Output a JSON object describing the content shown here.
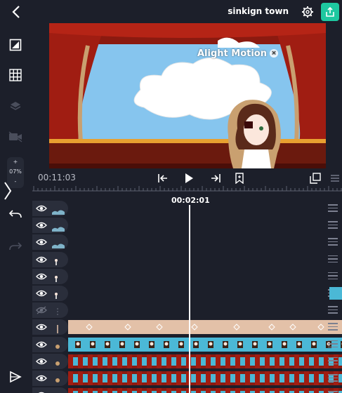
{
  "header": {
    "project_name": "sinkign town",
    "back_icon": "chevron-left-icon",
    "settings_icon": "gear-icon",
    "export_icon": "share-export-icon",
    "export_color": "#1ec8a0"
  },
  "left_tools": {
    "items": [
      "aspect-ratio-icon",
      "grid-icon",
      "layers-icon",
      "camera-icon"
    ],
    "zoom_plus": "+",
    "zoom_value": "07%",
    "zoom_minus": "-",
    "undo_icon": "undo-icon",
    "redo_icon": "redo-icon",
    "play_preview_icon": "play-outline-icon"
  },
  "preview": {
    "watermark_text": "Alight Motion",
    "watermark_close": "×"
  },
  "transport": {
    "timecode": "00:11:03",
    "playhead_time": "00:02:01",
    "buttons": [
      "skip-back-icon",
      "play-icon",
      "skip-forward-icon",
      "bookmark-icon",
      "copy-layer-icon",
      "list-handle-icon"
    ]
  },
  "tracks": [
    {
      "kind": "shape"
    },
    {
      "kind": "shape"
    },
    {
      "kind": "shape"
    },
    {
      "kind": "figure"
    },
    {
      "kind": "figure"
    },
    {
      "kind": "figure"
    },
    {
      "kind": "hidden"
    },
    {
      "kind": "peach-clip"
    },
    {
      "kind": "blue-clip"
    },
    {
      "kind": "film-clip"
    },
    {
      "kind": "film-clip"
    },
    {
      "kind": "film-clip"
    }
  ],
  "colors": {
    "background": "#1c1f2a",
    "peach_clip": "#e3c1a8",
    "blue_clip": "#4bb8d6",
    "curtain_red": "#8b1a10"
  }
}
